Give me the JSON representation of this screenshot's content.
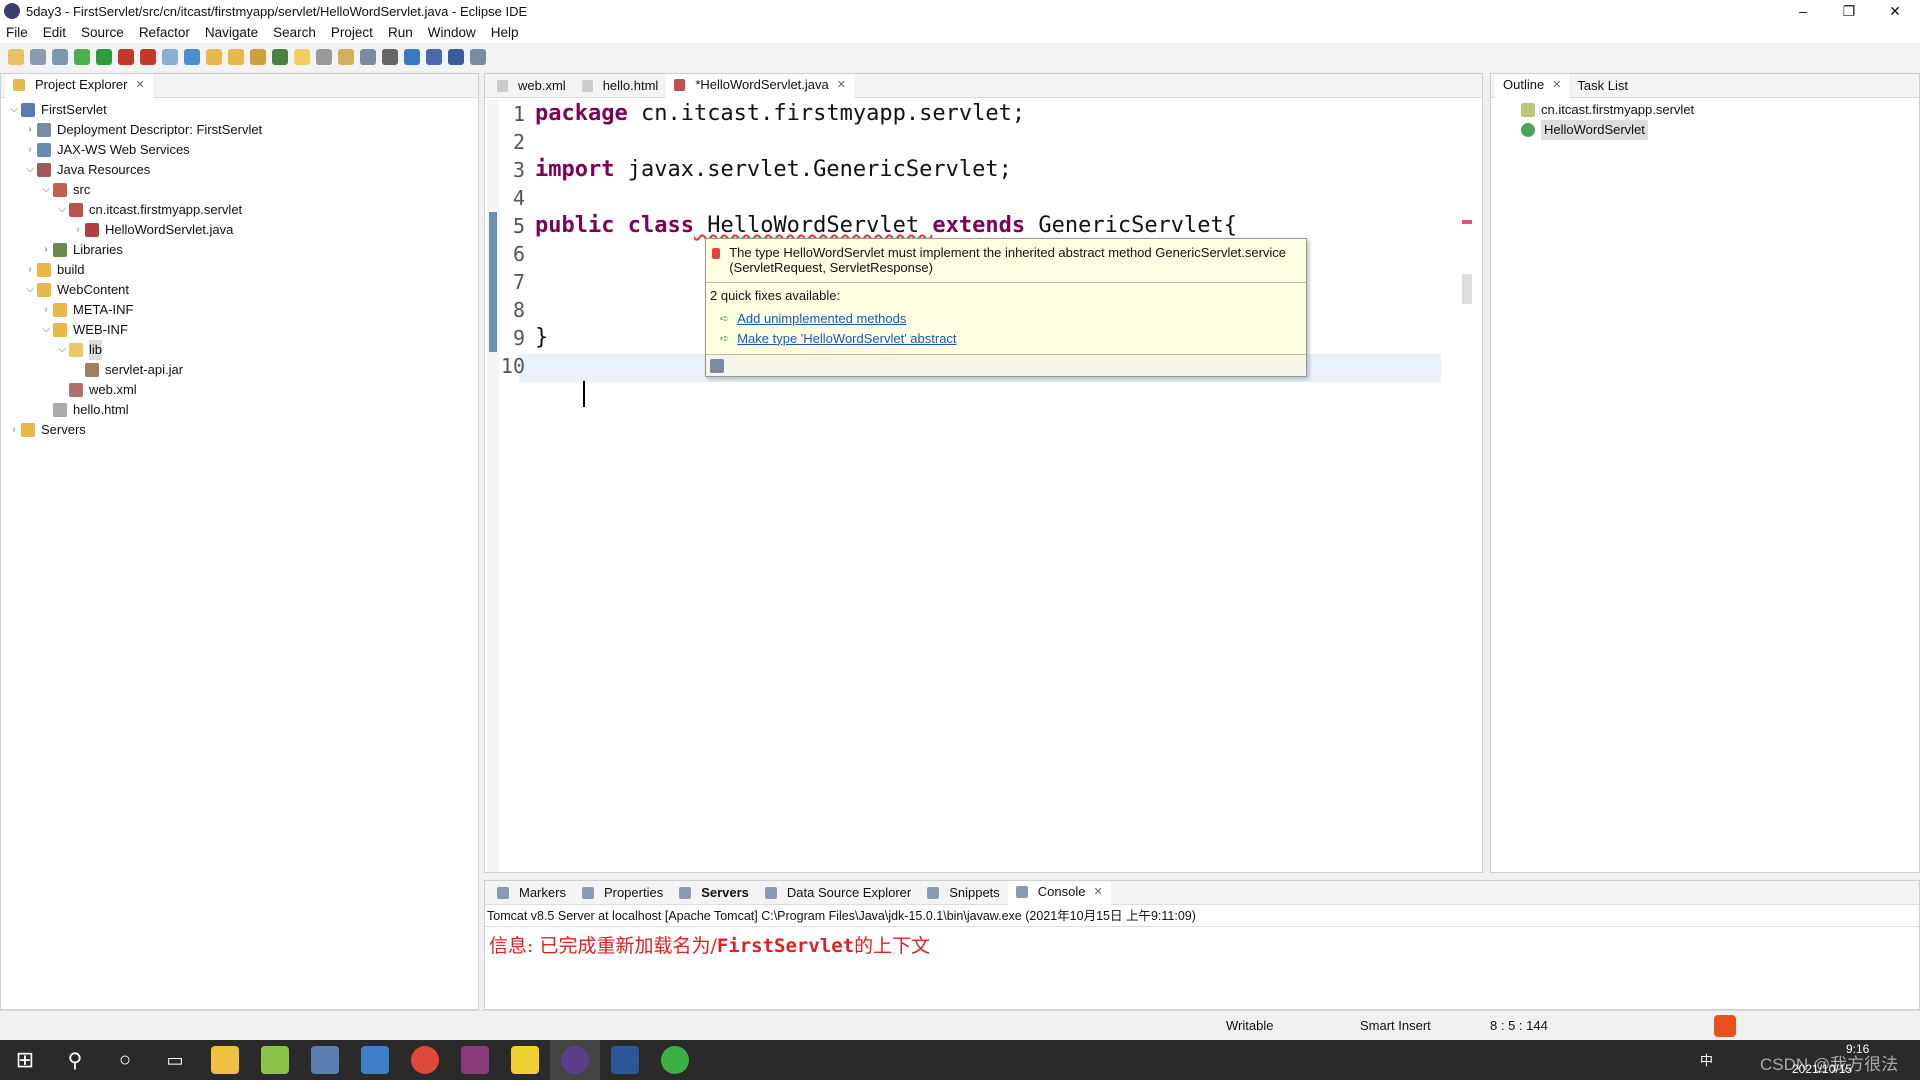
{
  "window": {
    "title": "5day3 - FirstServlet/src/cn/itcast/firstmyapp/servlet/HelloWordServlet.java - Eclipse IDE"
  },
  "menu": [
    "File",
    "Edit",
    "Source",
    "Refactor",
    "Navigate",
    "Search",
    "Project",
    "Run",
    "Window",
    "Help"
  ],
  "explorer": {
    "tab": "Project Explorer",
    "items": [
      {
        "label": "FirstServlet",
        "depth": 0,
        "arrow": "v",
        "icon": "project-icon"
      },
      {
        "label": "Deployment Descriptor: FirstServlet",
        "depth": 1,
        "arrow": ">",
        "icon": "descriptor-icon"
      },
      {
        "label": "JAX-WS Web Services",
        "depth": 1,
        "arrow": ">",
        "icon": "webservice-icon"
      },
      {
        "label": "Java Resources",
        "depth": 1,
        "arrow": "v",
        "icon": "java-resources-icon"
      },
      {
        "label": "src",
        "depth": 2,
        "arrow": "v",
        "icon": "source-folder-icon"
      },
      {
        "label": "cn.itcast.firstmyapp.servlet",
        "depth": 3,
        "arrow": "v",
        "icon": "package-icon"
      },
      {
        "label": "HelloWordServlet.java",
        "depth": 4,
        "arrow": ">",
        "icon": "java-file-icon"
      },
      {
        "label": "Libraries",
        "depth": 2,
        "arrow": ">",
        "icon": "library-icon"
      },
      {
        "label": "build",
        "depth": 1,
        "arrow": ">",
        "icon": "folder-icon"
      },
      {
        "label": "WebContent",
        "depth": 1,
        "arrow": "v",
        "icon": "folder-icon"
      },
      {
        "label": "META-INF",
        "depth": 2,
        "arrow": ">",
        "icon": "folder-icon"
      },
      {
        "label": "WEB-INF",
        "depth": 2,
        "arrow": "v",
        "icon": "folder-icon"
      },
      {
        "label": "lib",
        "depth": 3,
        "arrow": "v",
        "icon": "folder-open-icon"
      },
      {
        "label": "servlet-api.jar",
        "depth": 4,
        "arrow": "",
        "icon": "jar-icon"
      },
      {
        "label": "web.xml",
        "depth": 3,
        "arrow": "",
        "icon": "xml-file-icon"
      },
      {
        "label": "hello.html",
        "depth": 2,
        "arrow": "",
        "icon": "html-file-icon"
      },
      {
        "label": "Servers",
        "depth": 0,
        "arrow": ">",
        "icon": "folder-icon"
      }
    ]
  },
  "editor": {
    "tabs": [
      "web.xml",
      "hello.html",
      "*HelloWordServlet.java"
    ],
    "lines": [
      [
        {
          "t": "package",
          "k": 1
        },
        {
          "t": " cn.itcast.firstmyapp.servlet;"
        }
      ],
      [],
      [
        {
          "t": "import",
          "k": 1
        },
        {
          "t": " javax.servlet.GenericServlet;"
        }
      ],
      [],
      [
        {
          "t": "public",
          "k": 1
        },
        {
          "t": " "
        },
        {
          "t": "class",
          "k": 1
        },
        {
          "t": " HelloWordServlet "
        },
        {
          "t": "extends",
          "k": 1
        },
        {
          "t": " GenericServlet{"
        }
      ],
      [],
      [],
      [],
      [
        {
          "t": "}"
        }
      ],
      []
    ]
  },
  "tooltip": {
    "message": "The type HelloWordServlet must implement the inherited abstract method GenericServlet.service (ServletRequest, ServletResponse)",
    "fixes_title": "2 quick fixes available:",
    "fixes": [
      "Add unimplemented methods",
      "Make type 'HelloWordServlet' abstract"
    ]
  },
  "outline": {
    "tabs": [
      "Outline",
      "Task List"
    ],
    "items": [
      "cn.itcast.firstmyapp.servlet",
      "HelloWordServlet"
    ]
  },
  "bottom": {
    "tabs": [
      "Markers",
      "Properties",
      "Servers",
      "Data Source Explorer",
      "Snippets",
      "Console"
    ],
    "active": "Console",
    "header": "Tomcat v8.5 Server at localhost [Apache Tomcat] C:\\Program Files\\Java\\jdk-15.0.1\\bin\\javaw.exe  (2021年10月15日 上午9:11:09)",
    "console_prefix": "信息: 已完成重新加载名为/",
    "console_name": "FirstServlet",
    "console_suffix": "的上下文",
    "console_color": "#e02020"
  },
  "status": {
    "writable": "Writable",
    "insert": "Smart Insert",
    "position": "8 : 5 : 144"
  },
  "tray": {
    "time": "9:16",
    "date": "2021/10/15",
    "ime": "中",
    "watermark": "CSDN @我方很法"
  }
}
